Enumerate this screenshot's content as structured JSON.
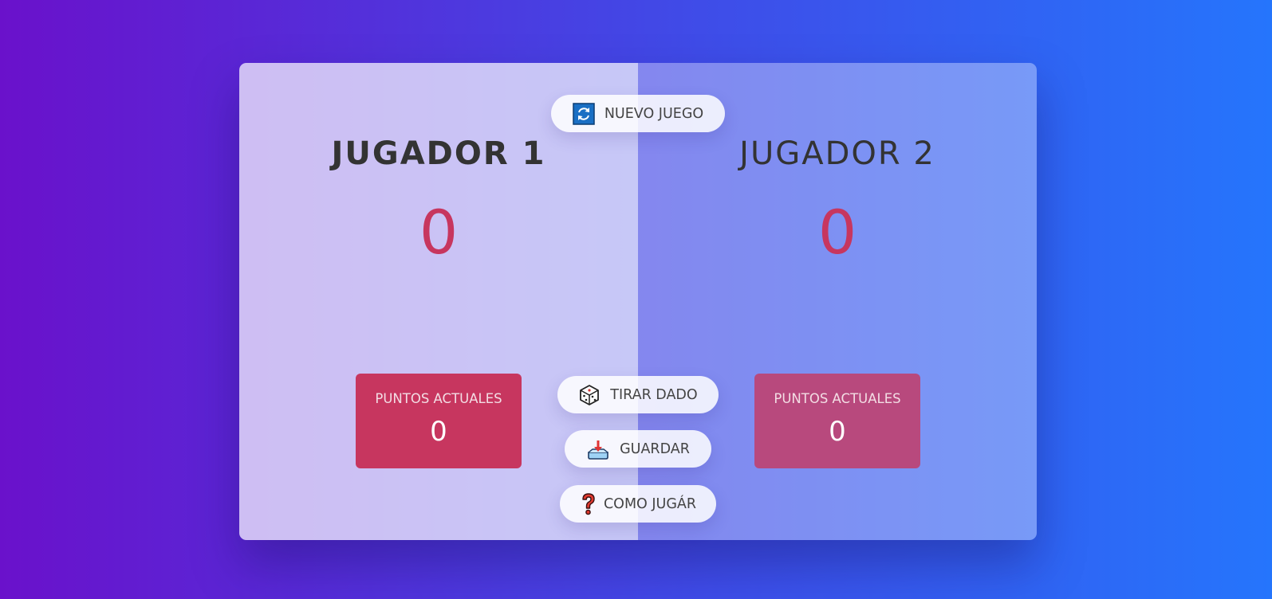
{
  "players": [
    {
      "name": "JUGADOR 1",
      "score": "0",
      "current_label": "PUNTOS ACTUALES",
      "current_value": "0"
    },
    {
      "name": "JUGADOR 2",
      "score": "0",
      "current_label": "PUNTOS ACTUALES",
      "current_value": "0"
    }
  ],
  "controls": {
    "new_game": {
      "label": "NUEVO JUEGO",
      "icon": "refresh-icon"
    },
    "roll": {
      "label": "TIRAR DADO",
      "icon": "dice-icon"
    },
    "hold": {
      "label": "GUARDAR",
      "icon": "save-icon"
    },
    "help": {
      "label": "COMO JUGÁR",
      "icon": "question-icon"
    }
  },
  "colors": {
    "background_start": "#6a11cb",
    "background_end": "#2575fc",
    "score": "#c7365f",
    "current_box_p1": "#c7365f",
    "current_box_p2": "#b8497d"
  }
}
